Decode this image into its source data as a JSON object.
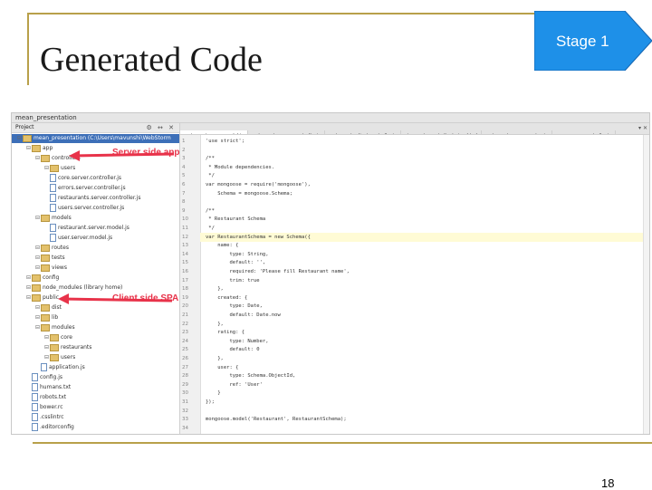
{
  "slide": {
    "title": "Generated Code",
    "stage_label": "Stage 1",
    "page_number": "18",
    "stage_color": "#1e90e8"
  },
  "ide": {
    "window_title": "mean_presentation",
    "project_header": "Project",
    "tree": [
      {
        "label": "mean_presentation (C:\\Users\\mavunshi\\WebStorm",
        "type": "folder",
        "selected": true
      },
      {
        "label": "app",
        "type": "folder"
      },
      {
        "label": "controllers",
        "type": "folder"
      },
      {
        "label": "users",
        "type": "folder"
      },
      {
        "label": "core.server.controller.js",
        "type": "file"
      },
      {
        "label": "errors.server.controller.js",
        "type": "file"
      },
      {
        "label": "restaurants.server.controller.js",
        "type": "file"
      },
      {
        "label": "users.server.controller.js",
        "type": "file"
      },
      {
        "label": "models",
        "type": "folder"
      },
      {
        "label": "restaurant.server.model.js",
        "type": "file"
      },
      {
        "label": "user.server.model.js",
        "type": "file"
      },
      {
        "label": "routes",
        "type": "folder"
      },
      {
        "label": "tests",
        "type": "folder"
      },
      {
        "label": "views",
        "type": "folder"
      },
      {
        "label": "config",
        "type": "folder"
      },
      {
        "label": "node_modules (library home)",
        "type": "folder"
      },
      {
        "label": "public",
        "type": "folder"
      },
      {
        "label": "dist",
        "type": "folder"
      },
      {
        "label": "lib",
        "type": "folder"
      },
      {
        "label": "modules",
        "type": "folder"
      },
      {
        "label": "core",
        "type": "folder"
      },
      {
        "label": "restaurants",
        "type": "folder"
      },
      {
        "label": "users",
        "type": "folder"
      },
      {
        "label": "application.js",
        "type": "file"
      },
      {
        "label": "config.js",
        "type": "file"
      },
      {
        "label": "humans.txt",
        "type": "file"
      },
      {
        "label": "robots.txt",
        "type": "file"
      },
      {
        "label": "bower.rc",
        "type": "file"
      },
      {
        "label": ".csslintrc",
        "type": "file"
      },
      {
        "label": ".editorconfig",
        "type": "file"
      }
    ],
    "tabs": [
      {
        "label": "restaurant.server.model.js",
        "active": true
      },
      {
        "label": "restaurants.server.controller.js",
        "active": false
      },
      {
        "label": "restaurants.client.controller.js",
        "active": false
      },
      {
        "label": "view-restaurant.client.view.html",
        "active": false
      },
      {
        "label": "restaurants.server.routes.js",
        "active": false
      },
      {
        "label": "users.server.controller.js",
        "active": false
      }
    ],
    "code": [
      {
        "n": "1",
        "text": "'use strict';"
      },
      {
        "n": "2",
        "text": ""
      },
      {
        "n": "3",
        "text": "/**"
      },
      {
        "n": "4",
        "text": " * Module dependencies."
      },
      {
        "n": "5",
        "text": " */"
      },
      {
        "n": "6",
        "text": "var mongoose = require('mongoose'),"
      },
      {
        "n": "7",
        "text": "    Schema = mongoose.Schema;"
      },
      {
        "n": "8",
        "text": ""
      },
      {
        "n": "9",
        "text": "/**"
      },
      {
        "n": "10",
        "text": " * Restaurant Schema"
      },
      {
        "n": "11",
        "text": " */"
      },
      {
        "n": "12",
        "text": "var RestaurantSchema = new Schema({",
        "hl": true
      },
      {
        "n": "13",
        "text": "    name: {"
      },
      {
        "n": "14",
        "text": "        type: String,"
      },
      {
        "n": "15",
        "text": "        default: '',"
      },
      {
        "n": "16",
        "text": "        required: 'Please fill Restaurant name',"
      },
      {
        "n": "17",
        "text": "        trim: true"
      },
      {
        "n": "18",
        "text": "    },"
      },
      {
        "n": "19",
        "text": "    created: {"
      },
      {
        "n": "20",
        "text": "        type: Date,"
      },
      {
        "n": "21",
        "text": "        default: Date.now"
      },
      {
        "n": "22",
        "text": "    },"
      },
      {
        "n": "23",
        "text": "    rating: {"
      },
      {
        "n": "24",
        "text": "        type: Number,"
      },
      {
        "n": "25",
        "text": "        default: 0"
      },
      {
        "n": "26",
        "text": "    },"
      },
      {
        "n": "27",
        "text": "    user: {"
      },
      {
        "n": "28",
        "text": "        type: Schema.ObjectId,"
      },
      {
        "n": "29",
        "text": "        ref: 'User'"
      },
      {
        "n": "30",
        "text": "    }"
      },
      {
        "n": "31",
        "text": "});"
      },
      {
        "n": "32",
        "text": ""
      },
      {
        "n": "33",
        "text": "mongoose.model('Restaurant', RestaurantSchema);"
      },
      {
        "n": "34",
        "text": ""
      }
    ]
  },
  "annotations": {
    "server": "Server side app",
    "client": "Client side SPA",
    "color": "#e8334a"
  }
}
